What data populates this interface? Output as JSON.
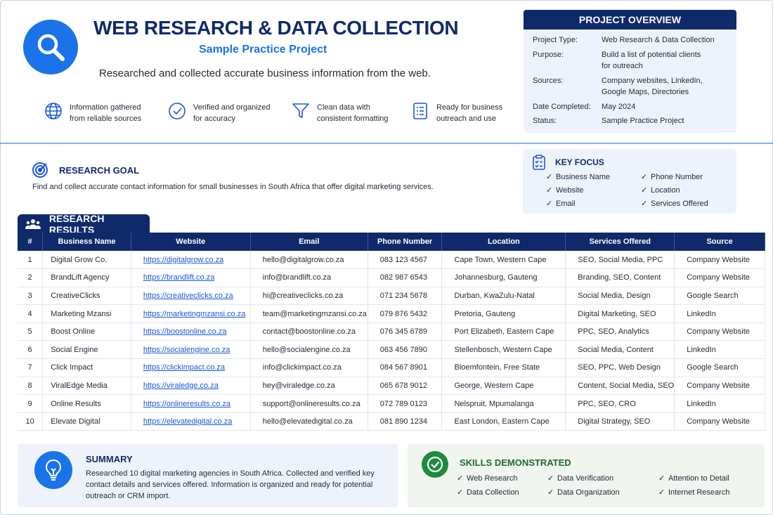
{
  "header": {
    "title": "WEB RESEARCH & DATA COLLECTION",
    "subtitle": "Sample Practice Project",
    "tagline": "Researched and collected accurate business information from the web.",
    "features": [
      {
        "icon": "globe-icon",
        "line1": "Information gathered",
        "line2": "from reliable sources"
      },
      {
        "icon": "check-circle-icon",
        "line1": "Verified and organized",
        "line2": "for accuracy"
      },
      {
        "icon": "filter-icon",
        "line1": "Clean data with",
        "line2": "consistent formatting"
      },
      {
        "icon": "list-document-icon",
        "line1": "Ready for business",
        "line2": "outreach and use"
      }
    ]
  },
  "overview": {
    "title": "PROJECT OVERVIEW",
    "rows": [
      {
        "key": "Project Type:",
        "value1": "Web Research & Data Collection",
        "value2": ""
      },
      {
        "key": "Purpose:",
        "value1": "Build a list of potential clients",
        "value2": "for outreach"
      },
      {
        "key": "Sources:",
        "value1": "Company websites, LinkedIn,",
        "value2": "Google Maps, Directories"
      },
      {
        "key": "Date Completed:",
        "value1": "May 2024",
        "value2": ""
      },
      {
        "key": "Status:",
        "value1": "Sample Practice Project",
        "value2": ""
      }
    ]
  },
  "goal": {
    "title": "RESEARCH GOAL",
    "text": "Find and collect accurate contact information for small businesses in South Africa that offer digital marketing services."
  },
  "key_focus": {
    "title": "KEY FOCUS",
    "items": [
      "Business Name",
      "Phone Number",
      "Website",
      "Location",
      "Email",
      "Services Offered"
    ]
  },
  "results": {
    "tab_label": "RESEARCH RESULTS",
    "columns": [
      "#",
      "Business Name",
      "Website",
      "Email",
      "Phone Number",
      "Location",
      "Services Offered",
      "Source"
    ],
    "rows": [
      [
        "1",
        "Digital Grow Co.",
        "https://digitalgrow.co.za",
        "hello@digitalgrow.co.za",
        "083 123 4567",
        "Cape Town, Western Cape",
        "SEO, Social Media, PPC",
        "Company Website"
      ],
      [
        "2",
        "BrandLift Agency",
        "https://brandlift.co.za",
        "info@brandlift.co.za",
        "082 987 6543",
        "Johannesburg, Gauteng",
        "Branding, SEO, Content",
        "Company Website"
      ],
      [
        "3",
        "CreativeClicks",
        "https://creativeclicks.co.za",
        "hi@creativeclicks.co.za",
        "071 234 5678",
        "Durban, KwaZulu-Natal",
        "Social Media, Design",
        "Google Search"
      ],
      [
        "4",
        "Marketing Mzansi",
        "https://marketingmzansi.co.za",
        "team@marketingmzansi.co.za",
        "079 876 5432",
        "Pretoria, Gauteng",
        "Digital Marketing, SEO",
        "LinkedIn"
      ],
      [
        "5",
        "Boost Online",
        "https://boostonline.co.za",
        "contact@boostonline.co.za",
        "076 345 6789",
        "Port Elizabeth, Eastern Cape",
        "PPC, SEO, Analytics",
        "Company Website"
      ],
      [
        "6",
        "Social Engine",
        "https://socialengine.co.za",
        "hello@socialengine.co.za",
        "063 456 7890",
        "Stellenbosch, Western Cape",
        "Social Media, Content",
        "LinkedIn"
      ],
      [
        "7",
        "Click Impact",
        "https://clickimpact.co.za",
        "info@clickimpact.co.za",
        "084 567 8901",
        "Bloemfontein, Free State",
        "SEO, PPC, Web Design",
        "Google Search"
      ],
      [
        "8",
        "ViralEdge Media",
        "https://viraledge.co.za",
        "hey@viraledge.co.za",
        "065 678 9012",
        "George, Western Cape",
        "Content, Social Media, SEO",
        "Company Website"
      ],
      [
        "9",
        "Online Results",
        "https://onlineresults.co.za",
        "support@onlineresults.co.za",
        "072 789 0123",
        "Nelspruit, Mpumalanga",
        "PPC, SEO, CRO",
        "LinkedIn"
      ],
      [
        "10",
        "Elevate Digital",
        "https://elevatedigital.co.za",
        "hello@elevatedigital.co.za",
        "081 890 1234",
        "East London, Eastern Cape",
        "Digital Strategy, SEO",
        "Company Website"
      ]
    ]
  },
  "summary": {
    "title": "SUMMARY",
    "text": "Researched 10 digital marketing agencies in South Africa. Collected and verified key contact details and services offered. Information is organized and ready for potential outreach or CRM import."
  },
  "skills": {
    "title": "SKILLS DEMONSTRATED",
    "items": [
      "Web Research",
      "Data Verification",
      "Attention to Detail",
      "Data Collection",
      "Data Organization",
      "Internet Research"
    ]
  },
  "colors": {
    "navy": "#0f2a6b",
    "accent_blue": "#1a73e8",
    "green": "#1e8a3e"
  }
}
